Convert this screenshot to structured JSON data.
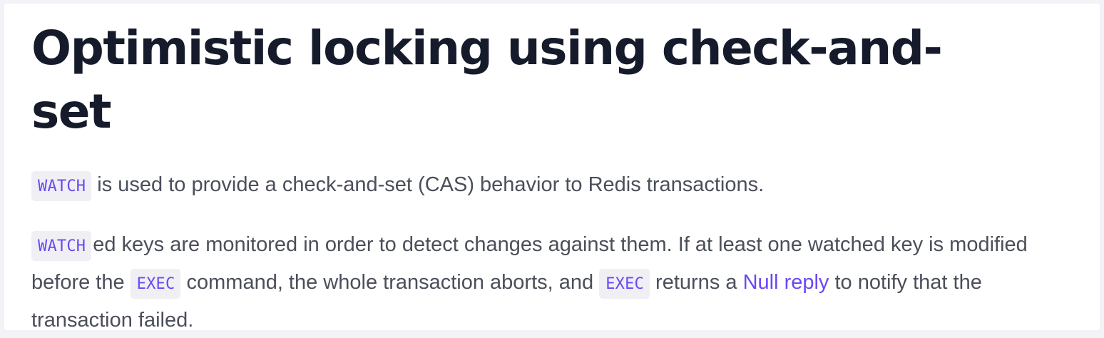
{
  "section": {
    "title": "Optimistic locking using check-and-set",
    "intro": {
      "code": "WATCH",
      "text": " is used to provide a check-and-set (CAS) behavior to Redis transactions."
    },
    "details": {
      "code1": "WATCH",
      "text1": "ed keys are monitored in order to detect changes against them. If at least one watched key is modified before the ",
      "code2": "EXEC",
      "text2": " command, the whole transaction aborts, and ",
      "code3": "EXEC",
      "text3": " returns a ",
      "link": "Null reply",
      "text4": " to notify that the transaction failed."
    }
  },
  "colors": {
    "page_background": "#f2f2f7",
    "card_background": "#ffffff",
    "heading": "#161b2c",
    "body_text": "#4b4f5a",
    "accent": "#6b47f5",
    "code_background": "#efeff4"
  }
}
